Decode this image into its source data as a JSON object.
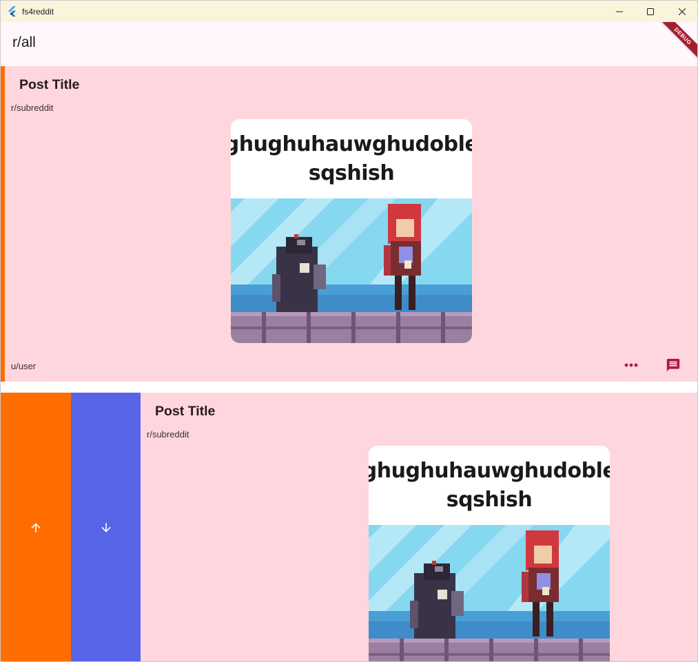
{
  "window": {
    "title": "fs4reddit"
  },
  "appbar": {
    "title": "r/all",
    "debug_label": "DEBUG"
  },
  "posts": [
    {
      "title": "Post Title",
      "subreddit": "r/subreddit",
      "user": "u/user",
      "image_caption_line1": "ghughuhauwghudoble",
      "image_caption_line2": "sqshish",
      "actions": [
        "more-horiz-icon",
        "comment-icon"
      ]
    },
    {
      "title": "Post Title",
      "subreddit": "r/subreddit",
      "image_caption_line1": "ghughuhauwghudoble",
      "image_caption_line2": "sqshish",
      "swipe_actions": [
        "arrow-up-icon",
        "arrow-down-icon"
      ]
    }
  ],
  "colors": {
    "card_bg": "#ffd6de",
    "upvote": "#ff6d00",
    "downvote": "#5865e6",
    "action_icon": "#b0124f",
    "appbar_bg": "#fff7fb"
  }
}
